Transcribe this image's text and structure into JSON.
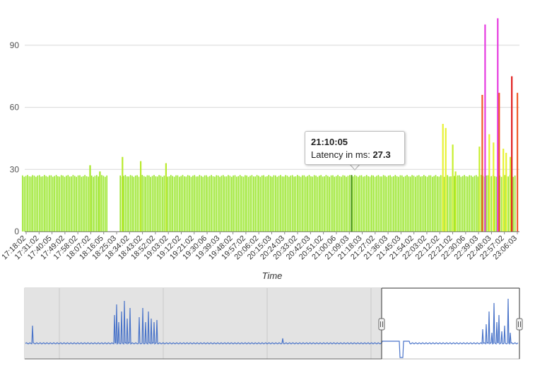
{
  "chart_data": [
    {
      "type": "bar",
      "title": "",
      "xlabel": "Time",
      "ylabel": "",
      "ylim": [
        0,
        105
      ],
      "yticks": [
        0,
        30,
        60,
        90
      ],
      "grid": true,
      "x_tick_labels": [
        "17:18:02",
        "17:31:02",
        "17:40:05",
        "17:49:02",
        "17:58:02",
        "18:07:02",
        "18:16:05",
        "18:25:03",
        "18:34:02",
        "18:43:02",
        "18:52:02",
        "19:03:02",
        "19:12:02",
        "19:21:02",
        "19:30:06",
        "19:39:03",
        "19:48:02",
        "19:57:02",
        "20:06:02",
        "20:15:03",
        "20:24:03",
        "20:33:02",
        "20:42:03",
        "20:51:02",
        "21:00:06",
        "21:09:03",
        "21:18:03",
        "21:27:02",
        "21:36:03",
        "21:45:03",
        "21:54:02",
        "22:03:02",
        "22:12:02",
        "22:21:02",
        "22:30:06",
        "22:39:03",
        "22:48:03",
        "22:57:02",
        "23:06:03"
      ],
      "baseline_value": 27,
      "gap": {
        "from": "18:16:05",
        "to": "18:25:03"
      },
      "spikes": [
        {
          "time": "18:04:00",
          "value": 32,
          "color": "#a5e526"
        },
        {
          "time": "18:11:00",
          "value": 29,
          "color": "#a5e526"
        },
        {
          "time": "18:27:00",
          "value": 36,
          "color": "#b8ea2c"
        },
        {
          "time": "18:40:00",
          "value": 34,
          "color": "#b8ea2c"
        },
        {
          "time": "18:58:00",
          "value": 33,
          "color": "#b8ea2c"
        },
        {
          "time": "22:15:00",
          "value": 52,
          "color": "#e8f233"
        },
        {
          "time": "22:17:00",
          "value": 50,
          "color": "#e8f233"
        },
        {
          "time": "22:22:00",
          "value": 42,
          "color": "#c7ef2e"
        },
        {
          "time": "22:24:00",
          "value": 29,
          "color": "#c7ef2e"
        },
        {
          "time": "22:41:00",
          "value": 41,
          "color": "#c7ef2e"
        },
        {
          "time": "22:43:00",
          "value": 66,
          "color": "#f05a28"
        },
        {
          "time": "22:45:00",
          "value": 100,
          "color": "#e63be0"
        },
        {
          "time": "22:48:00",
          "value": 47,
          "color": "#e8f233"
        },
        {
          "time": "22:51:00",
          "value": 43,
          "color": "#e8f233"
        },
        {
          "time": "22:54:00",
          "value": 103,
          "color": "#e63be0"
        },
        {
          "time": "22:55:00",
          "value": 67,
          "color": "#f05a28"
        },
        {
          "time": "22:58:00",
          "value": 40,
          "color": "#e8f233"
        },
        {
          "time": "23:00:00",
          "value": 38,
          "color": "#e8f233"
        },
        {
          "time": "23:03:00",
          "value": 36,
          "color": "#c7ef2e"
        },
        {
          "time": "23:04:00",
          "value": 75,
          "color": "#e02020"
        },
        {
          "time": "23:08:00",
          "value": 67,
          "color": "#f05a28"
        }
      ],
      "highlight": {
        "time": "21:10:05",
        "value": 27.3,
        "color": "#3f8f0f"
      },
      "bar_color": "#99e62a"
    },
    {
      "type": "area",
      "title": "",
      "role": "navigator",
      "selected_range": {
        "from": "17:18:02",
        "to": "23:06:03"
      },
      "line_color": "#4a74c9"
    }
  ],
  "tooltip": {
    "time": "21:10:05",
    "label": "Latency in ms: ",
    "value": "27.3"
  }
}
